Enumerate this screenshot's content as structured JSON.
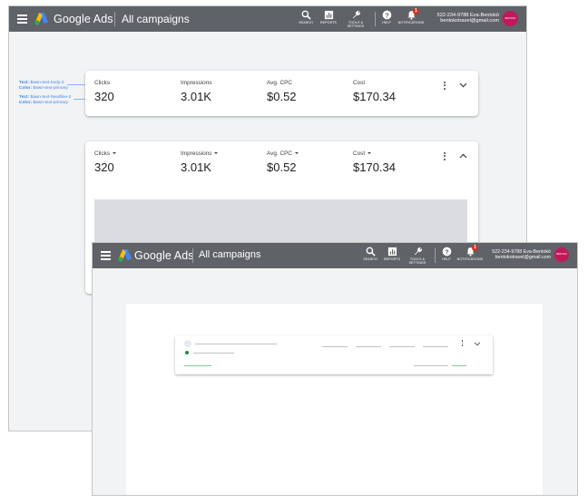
{
  "app": {
    "brand": "Google Ads",
    "page_title": "All campaigns"
  },
  "toolbar": {
    "search_label": "SEARCH",
    "reports_label": "REPORTS",
    "tools_label_1": "TOOLS &",
    "tools_label_2": "SETTINGS",
    "help_label": "HELP",
    "notifications_label": "NOTIFICATIONS",
    "notifications_count": "1"
  },
  "account": {
    "line1": "522-234-9788 Eva-Bentokō",
    "line2": "bentokotravel@gmail.com",
    "avatar_text": "BENTOKO"
  },
  "annotations": [
    {
      "text_key": "Text:",
      "text_val": "$awn-text-body-2",
      "color_key": "Color:",
      "color_val": "$awn-text-primary"
    },
    {
      "text_key": "Text:",
      "text_val": "$awn-text-headline-2",
      "color_key": "Color:",
      "color_val": "$awn-text-primary"
    }
  ],
  "card_collapsed": {
    "metrics": [
      {
        "label": "Clicks",
        "value": "320"
      },
      {
        "label": "Impressions",
        "value": "3.01K"
      },
      {
        "label": "Avg. CPC",
        "value": "$0.52"
      },
      {
        "label": "Cost",
        "value": "$170.34"
      }
    ]
  },
  "card_expanded": {
    "metrics": [
      {
        "label": "Clicks",
        "value": "320"
      },
      {
        "label": "Impressions",
        "value": "3.01K"
      },
      {
        "label": "Avg. CPC",
        "value": "$0.52"
      },
      {
        "label": "Cost",
        "value": "$170.34"
      }
    ]
  },
  "colors": {
    "topbar": "#5f6368",
    "accent_blue": "#4285f4",
    "avatar": "#c2185b",
    "badge": "#d93025",
    "skeleton_green": "#1e8e3e"
  },
  "icons": [
    "menu-icon",
    "google-ads-logo",
    "search-icon",
    "reports-icon",
    "tools-icon",
    "help-icon",
    "notifications-icon",
    "more-vert-icon",
    "chevron-down-icon",
    "chevron-up-icon",
    "dropdown-caret-icon"
  ]
}
